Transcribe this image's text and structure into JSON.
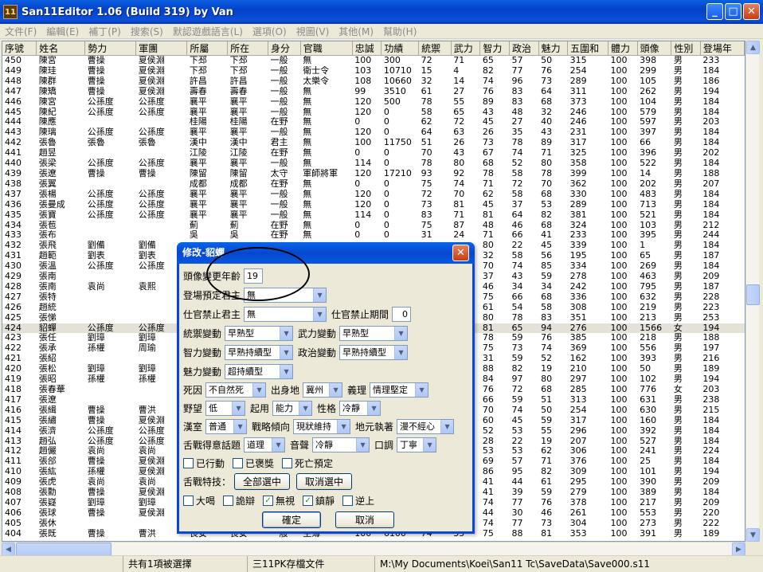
{
  "window": {
    "title": "San11Editor 1.06 (Build 319) by Van",
    "icon_label": "11",
    "minimize": "_",
    "maximize": "□",
    "close": "✕"
  },
  "menu": [
    {
      "label": "文件(F)",
      "en": false
    },
    {
      "label": "編輯(E)",
      "en": false
    },
    {
      "label": "補丁(P)",
      "en": false
    },
    {
      "label": "搜索(S)",
      "en": false
    },
    {
      "label": "默認遊戲語言(L)",
      "en": false
    },
    {
      "label": "選項(O)",
      "en": false
    },
    {
      "label": "視圖(V)",
      "en": false
    },
    {
      "label": "其他(M)",
      "en": false
    },
    {
      "label": "幫助(H)",
      "en": false
    }
  ],
  "grid": {
    "columns": [
      "序號",
      "姓名",
      "勢力",
      "軍團",
      "所屬",
      "所在",
      "身分",
      "官職",
      "忠誠",
      "功績",
      "統禦",
      "武力",
      "智力",
      "政治",
      "魅力",
      "五圍和",
      "體力",
      "頭像",
      "性別",
      "登場年"
    ],
    "rows": [
      [
        "450",
        "陳宮",
        "曹操",
        "夏侯淵",
        "下邳",
        "下邳",
        "一般",
        "無",
        "100",
        "300",
        "72",
        "71",
        "65",
        "57",
        "50",
        "315",
        "100",
        "398",
        "男",
        "233"
      ],
      [
        "449",
        "陳珪",
        "曹操",
        "夏侯淵",
        "下邳",
        "下邳",
        "一般",
        "衛士令",
        "103",
        "10710",
        "15",
        "4",
        "82",
        "77",
        "76",
        "254",
        "100",
        "299",
        "男",
        "184"
      ],
      [
        "448",
        "陳群",
        "曹操",
        "夏侯淵",
        "許昌",
        "許昌",
        "一般",
        "太樂令",
        "108",
        "10660",
        "32",
        "14",
        "74",
        "96",
        "73",
        "289",
        "100",
        "105",
        "男",
        "186"
      ],
      [
        "447",
        "陳矯",
        "曹操",
        "夏侯淵",
        "壽春",
        "壽春",
        "一般",
        "無",
        "99",
        "3510",
        "61",
        "27",
        "76",
        "83",
        "64",
        "311",
        "100",
        "262",
        "男",
        "194"
      ],
      [
        "446",
        "陳宮",
        "公孫度",
        "公孫度",
        "襄平",
        "襄平",
        "一般",
        "無",
        "120",
        "500",
        "78",
        "55",
        "89",
        "83",
        "68",
        "373",
        "100",
        "104",
        "男",
        "184"
      ],
      [
        "445",
        "陳紀",
        "公孫度",
        "公孫度",
        "襄平",
        "襄平",
        "一般",
        "無",
        "120",
        "0",
        "58",
        "65",
        "43",
        "48",
        "32",
        "246",
        "100",
        "579",
        "男",
        "184"
      ],
      [
        "444",
        "陳應",
        "",
        "",
        "桂陽",
        "桂陽",
        "在野",
        "無",
        "0",
        "0",
        "62",
        "72",
        "45",
        "27",
        "40",
        "246",
        "100",
        "597",
        "男",
        "203"
      ],
      [
        "443",
        "陳璃",
        "公孫度",
        "公孫度",
        "襄平",
        "襄平",
        "一般",
        "無",
        "120",
        "0",
        "64",
        "63",
        "26",
        "35",
        "43",
        "231",
        "100",
        "397",
        "男",
        "184"
      ],
      [
        "442",
        "張魯",
        "張魯",
        "張魯",
        "漢中",
        "漢中",
        "君主",
        "無",
        "100",
        "11750",
        "51",
        "26",
        "73",
        "78",
        "89",
        "317",
        "100",
        "66",
        "男",
        "184"
      ],
      [
        "441",
        "趙昱",
        "",
        "",
        "江陵",
        "江陵",
        "在野",
        "無",
        "0",
        "0",
        "70",
        "43",
        "67",
        "74",
        "71",
        "325",
        "100",
        "396",
        "男",
        "202"
      ],
      [
        "440",
        "張梁",
        "公孫度",
        "公孫度",
        "襄平",
        "襄平",
        "一般",
        "無",
        "114",
        "0",
        "78",
        "80",
        "68",
        "52",
        "80",
        "358",
        "100",
        "522",
        "男",
        "184"
      ],
      [
        "439",
        "張遼",
        "曹操",
        "曹操",
        "陳留",
        "陳留",
        "太守",
        "軍師將軍",
        "120",
        "17210",
        "93",
        "92",
        "78",
        "58",
        "78",
        "399",
        "100",
        "14",
        "男",
        "188"
      ],
      [
        "438",
        "張翼",
        "",
        "",
        "成都",
        "成都",
        "在野",
        "無",
        "0",
        "0",
        "75",
        "74",
        "71",
        "72",
        "70",
        "362",
        "100",
        "202",
        "男",
        "207"
      ],
      [
        "437",
        "張楊",
        "公孫度",
        "公孫度",
        "襄平",
        "襄平",
        "一般",
        "無",
        "120",
        "0",
        "72",
        "70",
        "62",
        "58",
        "68",
        "330",
        "100",
        "483",
        "男",
        "184"
      ],
      [
        "436",
        "張曼成",
        "公孫度",
        "公孫度",
        "襄平",
        "襄平",
        "一般",
        "無",
        "120",
        "0",
        "73",
        "81",
        "45",
        "37",
        "53",
        "289",
        "100",
        "713",
        "男",
        "184"
      ],
      [
        "435",
        "張寶",
        "公孫度",
        "公孫度",
        "襄平",
        "襄平",
        "一般",
        "無",
        "114",
        "0",
        "83",
        "71",
        "81",
        "64",
        "82",
        "381",
        "100",
        "521",
        "男",
        "184"
      ],
      [
        "434",
        "張苞",
        "",
        "",
        "薊",
        "薊",
        "在野",
        "無",
        "0",
        "0",
        "75",
        "87",
        "48",
        "46",
        "68",
        "324",
        "100",
        "103",
        "男",
        "212"
      ],
      [
        "433",
        "張布",
        "",
        "",
        "吳",
        "吳",
        "在野",
        "無",
        "0",
        "0",
        "31",
        "24",
        "71",
        "66",
        "41",
        "233",
        "100",
        "395",
        "男",
        "244"
      ],
      [
        "432",
        "張飛",
        "劉備",
        "劉備",
        "",
        "",
        "",
        "",
        "",
        "",
        "",
        "",
        "80",
        "22",
        "45",
        "339",
        "100",
        "1",
        "男",
        "184"
      ],
      [
        "431",
        "趙範",
        "劉表",
        "劉表",
        "",
        "",
        "",
        "",
        "",
        "",
        "",
        "",
        "32",
        "58",
        "56",
        "195",
        "100",
        "65",
        "男",
        "187"
      ],
      [
        "430",
        "張溫",
        "公孫度",
        "公孫度",
        "",
        "",
        "",
        "",
        "",
        "",
        "",
        "",
        "70",
        "74",
        "85",
        "334",
        "100",
        "269",
        "男",
        "184"
      ],
      [
        "429",
        "張南",
        "",
        "",
        "",
        "",
        "",
        "",
        "",
        "",
        "",
        "",
        "37",
        "43",
        "59",
        "278",
        "100",
        "463",
        "男",
        "209"
      ],
      [
        "428",
        "張南",
        "袁尚",
        "袁熙",
        "",
        "",
        "",
        "",
        "",
        "",
        "",
        "",
        "46",
        "34",
        "34",
        "242",
        "100",
        "795",
        "男",
        "187"
      ],
      [
        "427",
        "張特",
        "",
        "",
        "",
        "",
        "",
        "",
        "",
        "",
        "",
        "",
        "75",
        "66",
        "68",
        "336",
        "100",
        "632",
        "男",
        "228"
      ],
      [
        "426",
        "趙統",
        "",
        "",
        "",
        "",
        "",
        "",
        "",
        "",
        "",
        "",
        "61",
        "54",
        "58",
        "308",
        "100",
        "219",
        "男",
        "223"
      ],
      [
        "425",
        "張悌",
        "",
        "",
        "",
        "",
        "",
        "",
        "",
        "",
        "",
        "",
        "80",
        "78",
        "83",
        "351",
        "100",
        "213",
        "男",
        "253"
      ],
      [
        "424",
        "貂蟬",
        "公孫度",
        "公孫度",
        "",
        "",
        "",
        "",
        "",
        "",
        "",
        "",
        "81",
        "65",
        "94",
        "276",
        "100",
        "1566",
        "女",
        "194"
      ],
      [
        "423",
        "張任",
        "劉璋",
        "劉璋",
        "",
        "",
        "",
        "",
        "",
        "",
        "",
        "",
        "78",
        "59",
        "76",
        "385",
        "100",
        "218",
        "男",
        "188"
      ],
      [
        "422",
        "張承",
        "孫權",
        "周瑜",
        "",
        "",
        "",
        "",
        "",
        "",
        "",
        "",
        "75",
        "73",
        "74",
        "369",
        "100",
        "556",
        "男",
        "197"
      ],
      [
        "421",
        "張紹",
        "",
        "",
        "",
        "",
        "",
        "",
        "",
        "",
        "",
        "",
        "31",
        "59",
        "52",
        "162",
        "100",
        "393",
        "男",
        "216"
      ],
      [
        "420",
        "張松",
        "劉璋",
        "劉璋",
        "",
        "",
        "",
        "",
        "",
        "",
        "",
        "",
        "88",
        "82",
        "19",
        "210",
        "100",
        "50",
        "男",
        "189"
      ],
      [
        "419",
        "張昭",
        "孫權",
        "孫權",
        "",
        "",
        "",
        "",
        "",
        "",
        "",
        "",
        "84",
        "97",
        "80",
        "297",
        "100",
        "102",
        "男",
        "194"
      ],
      [
        "418",
        "張春華",
        "",
        "",
        "",
        "",
        "",
        "",
        "",
        "",
        "",
        "",
        "76",
        "72",
        "68",
        "285",
        "100",
        "776",
        "女",
        "203"
      ],
      [
        "417",
        "張遼",
        "",
        "",
        "",
        "",
        "",
        "",
        "",
        "",
        "",
        "",
        "66",
        "59",
        "51",
        "313",
        "100",
        "631",
        "男",
        "238"
      ],
      [
        "416",
        "張緝",
        "曹操",
        "曹洪",
        "",
        "",
        "",
        "",
        "",
        "",
        "",
        "",
        "70",
        "74",
        "50",
        "254",
        "100",
        "630",
        "男",
        "215"
      ],
      [
        "415",
        "張繡",
        "曹操",
        "夏侯淵",
        "",
        "",
        "",
        "",
        "",
        "",
        "",
        "",
        "60",
        "45",
        "59",
        "317",
        "100",
        "160",
        "男",
        "184"
      ],
      [
        "414",
        "張濟",
        "公孫度",
        "公孫度",
        "",
        "",
        "",
        "",
        "",
        "",
        "",
        "",
        "52",
        "53",
        "55",
        "296",
        "100",
        "392",
        "男",
        "184"
      ],
      [
        "413",
        "趙弘",
        "公孫度",
        "公孫度",
        "",
        "",
        "",
        "",
        "",
        "",
        "",
        "",
        "28",
        "22",
        "19",
        "207",
        "100",
        "527",
        "男",
        "184"
      ],
      [
        "412",
        "趙儼",
        "袁尚",
        "袁尚",
        "",
        "",
        "",
        "",
        "",
        "",
        "",
        "",
        "53",
        "53",
        "62",
        "306",
        "100",
        "241",
        "男",
        "224"
      ],
      [
        "411",
        "張郃",
        "曹操",
        "夏侯淵",
        "",
        "",
        "",
        "",
        "",
        "",
        "",
        "",
        "69",
        "57",
        "71",
        "376",
        "100",
        "25",
        "男",
        "184"
      ],
      [
        "410",
        "張紘",
        "孫權",
        "夏侯淵",
        "",
        "",
        "",
        "",
        "",
        "",
        "",
        "",
        "86",
        "95",
        "82",
        "309",
        "100",
        "101",
        "男",
        "194"
      ],
      [
        "409",
        "張虎",
        "袁尚",
        "袁尚",
        "",
        "",
        "",
        "",
        "",
        "",
        "",
        "",
        "41",
        "44",
        "61",
        "295",
        "100",
        "390",
        "男",
        "209"
      ],
      [
        "408",
        "張勳",
        "曹操",
        "夏侯淵",
        "",
        "",
        "",
        "",
        "",
        "",
        "",
        "",
        "41",
        "39",
        "59",
        "279",
        "100",
        "389",
        "男",
        "184"
      ],
      [
        "407",
        "張嶷",
        "劉璋",
        "劉璋",
        "",
        "",
        "",
        "",
        "",
        "",
        "",
        "",
        "74",
        "77",
        "76",
        "378",
        "100",
        "217",
        "男",
        "209"
      ],
      [
        "406",
        "張球",
        "曹操",
        "夏侯淵",
        "",
        "",
        "",
        "",
        "",
        "",
        "",
        "",
        "44",
        "30",
        "46",
        "261",
        "100",
        "553",
        "男",
        "220"
      ],
      [
        "405",
        "張休",
        "",
        "",
        "",
        "",
        "",
        "",
        "",
        "",
        "",
        "",
        "74",
        "77",
        "73",
        "304",
        "100",
        "273",
        "男",
        "222"
      ],
      [
        "404",
        "張既",
        "曹操",
        "曹洪",
        "長安",
        "長安",
        "一般",
        "主簿",
        "100",
        "6100",
        "74",
        "35",
        "75",
        "88",
        "81",
        "353",
        "100",
        "391",
        "男",
        "189"
      ]
    ],
    "selected_row": 26
  },
  "statusbar": {
    "selection": "共有1項被選擇",
    "format": "三11PK存檔文件",
    "path": "M:\\My Documents\\Koei\\San11 Tc\\SaveData\\Save000.s11"
  },
  "dialog": {
    "title": "修改-貂蟬",
    "close": "✕",
    "portrait_age_label": "頭像變更年齡",
    "portrait_age_value": "19",
    "appear_lord_label": "登場預定君主",
    "appear_lord_value": "無",
    "ban_lord_label": "仕官禁止君主",
    "ban_lord_value": "無",
    "ban_period_label": "仕官禁止期間",
    "ban_period_value": "0",
    "lead_growth_label": "統禦變動",
    "lead_growth_value": "早熟型",
    "war_growth_label": "武力變動",
    "war_growth_value": "早熟型",
    "int_growth_label": "智力變動",
    "int_growth_value": "早熟持續型",
    "pol_growth_label": "政治變動",
    "pol_growth_value": "早熟持續型",
    "cha_growth_label": "魅力變動",
    "cha_growth_value": "超持續型",
    "death_label": "死因",
    "death_value": "不自然死",
    "birthplace_label": "出身地",
    "birthplace_value": "冀州",
    "righteousness_label": "義理",
    "righteousness_value": "情理堅定",
    "ambition_label": "野望",
    "ambition_value": "低",
    "use_label": "起用",
    "use_value": "能力",
    "personality_label": "性格",
    "personality_value": "冷靜",
    "han_label": "漢室",
    "han_value": "普通",
    "strategy_label": "戰略傾向",
    "strategy_value": "現狀維持",
    "local_label": "地元執著",
    "local_value": "漫不經心",
    "debate_topic_label": "舌戰得意話題",
    "debate_topic_value": "道理",
    "voice_label": "音聲",
    "voice_value": "冷靜",
    "tone_label": "口調",
    "tone_value": "丁寧",
    "acted_label": "已行動",
    "rewarded_label": "已褒獎",
    "death_planned_label": "死亡預定",
    "debate_skill_label": "舌戰特技：",
    "select_all_label": "全部選中",
    "unselect_all_label": "取消選中",
    "skills": [
      {
        "label": "大喝",
        "checked": false
      },
      {
        "label": "詭辯",
        "checked": false
      },
      {
        "label": "無視",
        "checked": true
      },
      {
        "label": "鎮靜",
        "checked": true
      },
      {
        "label": "逆上",
        "checked": false
      }
    ],
    "ok_label": "確定",
    "cancel_label": "取消"
  }
}
